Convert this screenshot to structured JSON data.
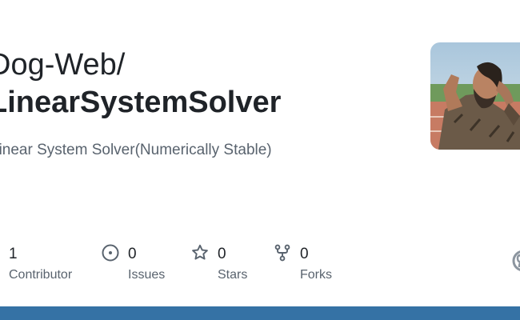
{
  "repo": {
    "owner": "Dog-Web/",
    "name": "LinearSystemSolver",
    "description": "Linear System Solver(Numerically Stable)"
  },
  "stats": [
    {
      "icon": "contributors-icon",
      "value": "1",
      "label": "Contributor"
    },
    {
      "icon": "issues-icon",
      "value": "0",
      "label": "Issues"
    },
    {
      "icon": "star-icon",
      "value": "0",
      "label": "Stars"
    },
    {
      "icon": "fork-icon",
      "value": "0",
      "label": "Forks"
    }
  ],
  "colors": {
    "language_bar": "#3572a5",
    "text_primary": "#1f2328",
    "text_muted": "#59636e"
  }
}
